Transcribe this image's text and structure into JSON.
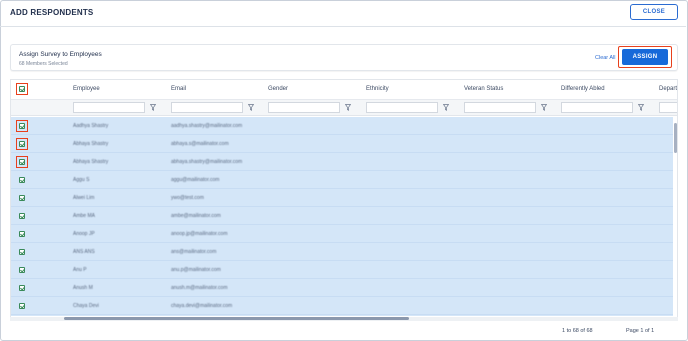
{
  "header": {
    "title": "ADD RESPONDENTS",
    "close_label": "CLOSE"
  },
  "assign_panel": {
    "title": "Assign Survey to Employees",
    "subtitle": "68 Members Selected",
    "clear_all_label": "Clear All",
    "assign_label": "ASSIGN"
  },
  "columns": [
    "Employee",
    "Email",
    "Gender",
    "Ethnicity",
    "Veteran Status",
    "Differently Abled",
    "Departm"
  ],
  "rows": [
    {
      "name": "Aadhya Shastry",
      "email": "aadhya.shastry@mailinator.com"
    },
    {
      "name": "Abhaya Shastry",
      "email": "abhaya.s@mailinator.com"
    },
    {
      "name": "Abhaya Shastry",
      "email": "abhaya.shastry@mailinator.com"
    },
    {
      "name": "Aggu S",
      "email": "aggu@mailinator.com"
    },
    {
      "name": "Alwei Lim",
      "email": "ywo@test.com"
    },
    {
      "name": "Ambe MA",
      "email": "ambe@mailinator.com"
    },
    {
      "name": "Anoop JP",
      "email": "anoop.jp@mailinator.com"
    },
    {
      "name": "ANS ANS",
      "email": "ans@mailinator.com"
    },
    {
      "name": "Anu P",
      "email": "anu.p@mailinator.com"
    },
    {
      "name": "Anush M",
      "email": "anush.m@mailinator.com"
    },
    {
      "name": "Chaya Devi",
      "email": "chaya.devi@mailinator.com"
    }
  ],
  "footer": {
    "count": "1 to 68 of 68",
    "page": "Page 1 of 1"
  },
  "colors": {
    "accent": "#1769d9",
    "highlight": "#e8401c",
    "selected_row": "#d4e6f8"
  },
  "icons": [
    "filter-icon",
    "checkbox-checked-icon"
  ]
}
